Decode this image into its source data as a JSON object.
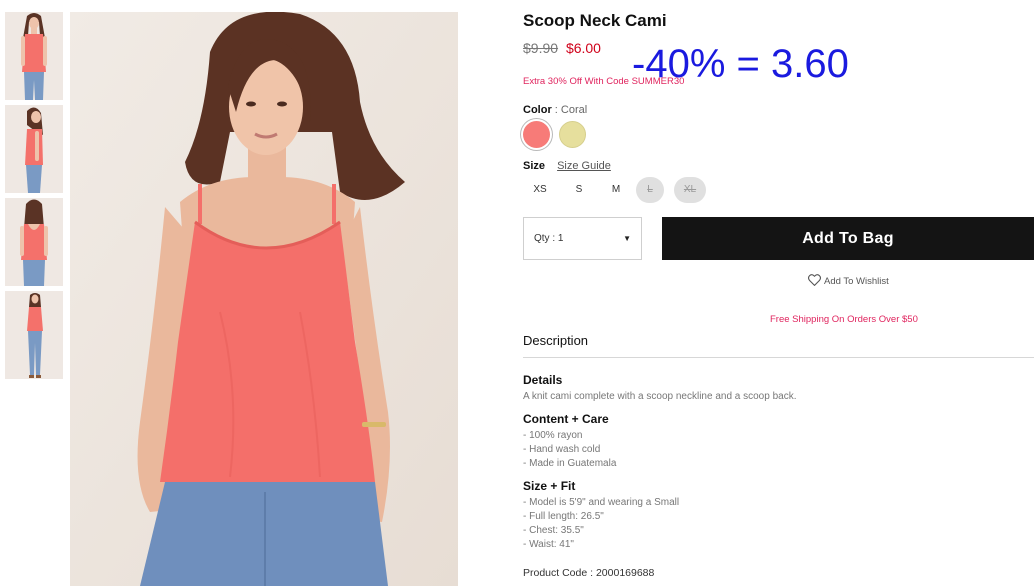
{
  "product": {
    "title": "Scoop Neck Cami",
    "price_original": "$9.90",
    "price_sale": "$6.00",
    "promo_text": "Extra 30% Off With Code SUMMER30",
    "overlay_text": "-40% = 3.60",
    "color_label": "Color",
    "color_separator": ":",
    "color_value": "Coral",
    "swatches": [
      {
        "name": "Coral",
        "color": "#f77b78",
        "selected": true
      },
      {
        "name": "Yellow",
        "color": "#e6df9d",
        "selected": false
      }
    ],
    "size_label": "Size",
    "size_guide": "Size Guide",
    "sizes": [
      {
        "label": "XS",
        "available": true
      },
      {
        "label": "S",
        "available": true
      },
      {
        "label": "M",
        "available": true
      },
      {
        "label": "L",
        "available": false
      },
      {
        "label": "XL",
        "available": false
      }
    ],
    "qty_label": "Qty : 1",
    "add_to_bag": "Add To Bag",
    "wishlist": "Add To Wishlist",
    "shipping": "Free Shipping On Orders Over $50",
    "description_title": "Description",
    "details_title": "Details",
    "details_text": "A knit cami complete with a scoop neckline and a scoop back.",
    "content_title": "Content + Care",
    "content_lines": [
      "- 100% rayon",
      "- Hand wash cold",
      "- Made in Guatemala"
    ],
    "fit_title": "Size + Fit",
    "fit_lines": [
      "- Model is 5'9\" and wearing a Small",
      "- Full length: 26.5\"",
      "- Chest: 35.5\"",
      "- Waist: 41\""
    ],
    "product_code": "Product Code : 2000169688"
  },
  "colors": {
    "sale_red": "#d0021b",
    "promo_pink": "#e0245e",
    "overlay_blue": "#1a1adf",
    "button_black": "#141414",
    "garment_coral": "#f46f6a"
  }
}
